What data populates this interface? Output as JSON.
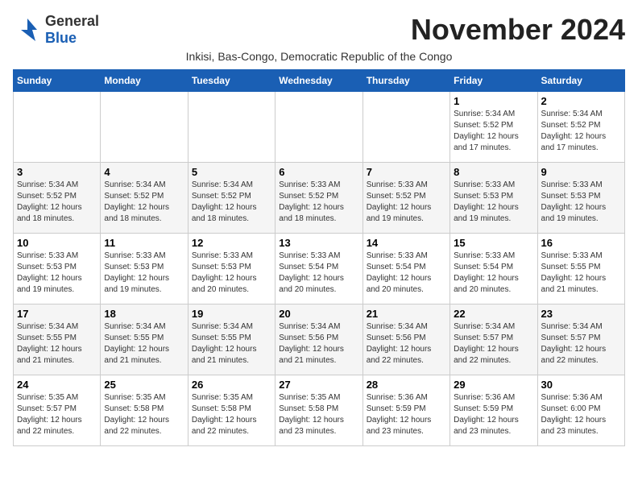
{
  "header": {
    "logo_general": "General",
    "logo_blue": "Blue",
    "month_title": "November 2024",
    "subtitle": "Inkisi, Bas-Congo, Democratic Republic of the Congo"
  },
  "weekdays": [
    "Sunday",
    "Monday",
    "Tuesday",
    "Wednesday",
    "Thursday",
    "Friday",
    "Saturday"
  ],
  "weeks": [
    [
      {
        "day": "",
        "info": ""
      },
      {
        "day": "",
        "info": ""
      },
      {
        "day": "",
        "info": ""
      },
      {
        "day": "",
        "info": ""
      },
      {
        "day": "",
        "info": ""
      },
      {
        "day": "1",
        "info": "Sunrise: 5:34 AM\nSunset: 5:52 PM\nDaylight: 12 hours\nand 17 minutes."
      },
      {
        "day": "2",
        "info": "Sunrise: 5:34 AM\nSunset: 5:52 PM\nDaylight: 12 hours\nand 17 minutes."
      }
    ],
    [
      {
        "day": "3",
        "info": "Sunrise: 5:34 AM\nSunset: 5:52 PM\nDaylight: 12 hours\nand 18 minutes."
      },
      {
        "day": "4",
        "info": "Sunrise: 5:34 AM\nSunset: 5:52 PM\nDaylight: 12 hours\nand 18 minutes."
      },
      {
        "day": "5",
        "info": "Sunrise: 5:34 AM\nSunset: 5:52 PM\nDaylight: 12 hours\nand 18 minutes."
      },
      {
        "day": "6",
        "info": "Sunrise: 5:33 AM\nSunset: 5:52 PM\nDaylight: 12 hours\nand 18 minutes."
      },
      {
        "day": "7",
        "info": "Sunrise: 5:33 AM\nSunset: 5:52 PM\nDaylight: 12 hours\nand 19 minutes."
      },
      {
        "day": "8",
        "info": "Sunrise: 5:33 AM\nSunset: 5:53 PM\nDaylight: 12 hours\nand 19 minutes."
      },
      {
        "day": "9",
        "info": "Sunrise: 5:33 AM\nSunset: 5:53 PM\nDaylight: 12 hours\nand 19 minutes."
      }
    ],
    [
      {
        "day": "10",
        "info": "Sunrise: 5:33 AM\nSunset: 5:53 PM\nDaylight: 12 hours\nand 19 minutes."
      },
      {
        "day": "11",
        "info": "Sunrise: 5:33 AM\nSunset: 5:53 PM\nDaylight: 12 hours\nand 19 minutes."
      },
      {
        "day": "12",
        "info": "Sunrise: 5:33 AM\nSunset: 5:53 PM\nDaylight: 12 hours\nand 20 minutes."
      },
      {
        "day": "13",
        "info": "Sunrise: 5:33 AM\nSunset: 5:54 PM\nDaylight: 12 hours\nand 20 minutes."
      },
      {
        "day": "14",
        "info": "Sunrise: 5:33 AM\nSunset: 5:54 PM\nDaylight: 12 hours\nand 20 minutes."
      },
      {
        "day": "15",
        "info": "Sunrise: 5:33 AM\nSunset: 5:54 PM\nDaylight: 12 hours\nand 20 minutes."
      },
      {
        "day": "16",
        "info": "Sunrise: 5:33 AM\nSunset: 5:55 PM\nDaylight: 12 hours\nand 21 minutes."
      }
    ],
    [
      {
        "day": "17",
        "info": "Sunrise: 5:34 AM\nSunset: 5:55 PM\nDaylight: 12 hours\nand 21 minutes."
      },
      {
        "day": "18",
        "info": "Sunrise: 5:34 AM\nSunset: 5:55 PM\nDaylight: 12 hours\nand 21 minutes."
      },
      {
        "day": "19",
        "info": "Sunrise: 5:34 AM\nSunset: 5:55 PM\nDaylight: 12 hours\nand 21 minutes."
      },
      {
        "day": "20",
        "info": "Sunrise: 5:34 AM\nSunset: 5:56 PM\nDaylight: 12 hours\nand 21 minutes."
      },
      {
        "day": "21",
        "info": "Sunrise: 5:34 AM\nSunset: 5:56 PM\nDaylight: 12 hours\nand 22 minutes."
      },
      {
        "day": "22",
        "info": "Sunrise: 5:34 AM\nSunset: 5:57 PM\nDaylight: 12 hours\nand 22 minutes."
      },
      {
        "day": "23",
        "info": "Sunrise: 5:34 AM\nSunset: 5:57 PM\nDaylight: 12 hours\nand 22 minutes."
      }
    ],
    [
      {
        "day": "24",
        "info": "Sunrise: 5:35 AM\nSunset: 5:57 PM\nDaylight: 12 hours\nand 22 minutes."
      },
      {
        "day": "25",
        "info": "Sunrise: 5:35 AM\nSunset: 5:58 PM\nDaylight: 12 hours\nand 22 minutes."
      },
      {
        "day": "26",
        "info": "Sunrise: 5:35 AM\nSunset: 5:58 PM\nDaylight: 12 hours\nand 22 minutes."
      },
      {
        "day": "27",
        "info": "Sunrise: 5:35 AM\nSunset: 5:58 PM\nDaylight: 12 hours\nand 23 minutes."
      },
      {
        "day": "28",
        "info": "Sunrise: 5:36 AM\nSunset: 5:59 PM\nDaylight: 12 hours\nand 23 minutes."
      },
      {
        "day": "29",
        "info": "Sunrise: 5:36 AM\nSunset: 5:59 PM\nDaylight: 12 hours\nand 23 minutes."
      },
      {
        "day": "30",
        "info": "Sunrise: 5:36 AM\nSunset: 6:00 PM\nDaylight: 12 hours\nand 23 minutes."
      }
    ]
  ]
}
